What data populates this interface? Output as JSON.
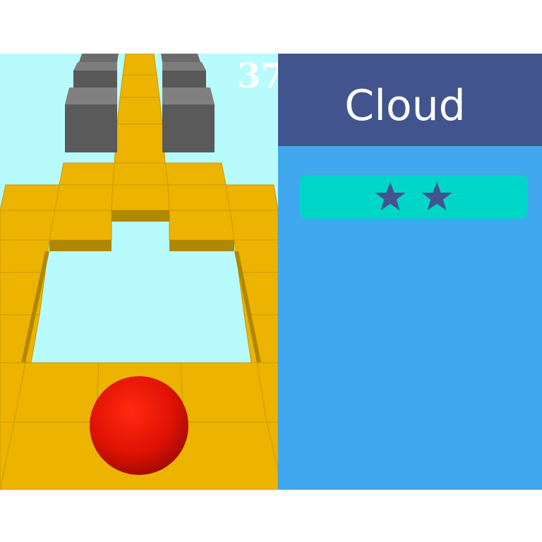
{
  "hud": {
    "score": "37"
  },
  "level": {
    "name": "Cloud",
    "stars_earned": 2,
    "star_icon": "star-icon"
  },
  "colors": {
    "sky": "#b7fbfd",
    "tile": "#ecb300",
    "tile_side": "#b08700",
    "ball": "#e01204",
    "block": "#5f5f5f",
    "panel_header": "#42548e",
    "panel_body": "#41a7ee",
    "star_pill": "#00d6c8",
    "star": "#42548e"
  }
}
